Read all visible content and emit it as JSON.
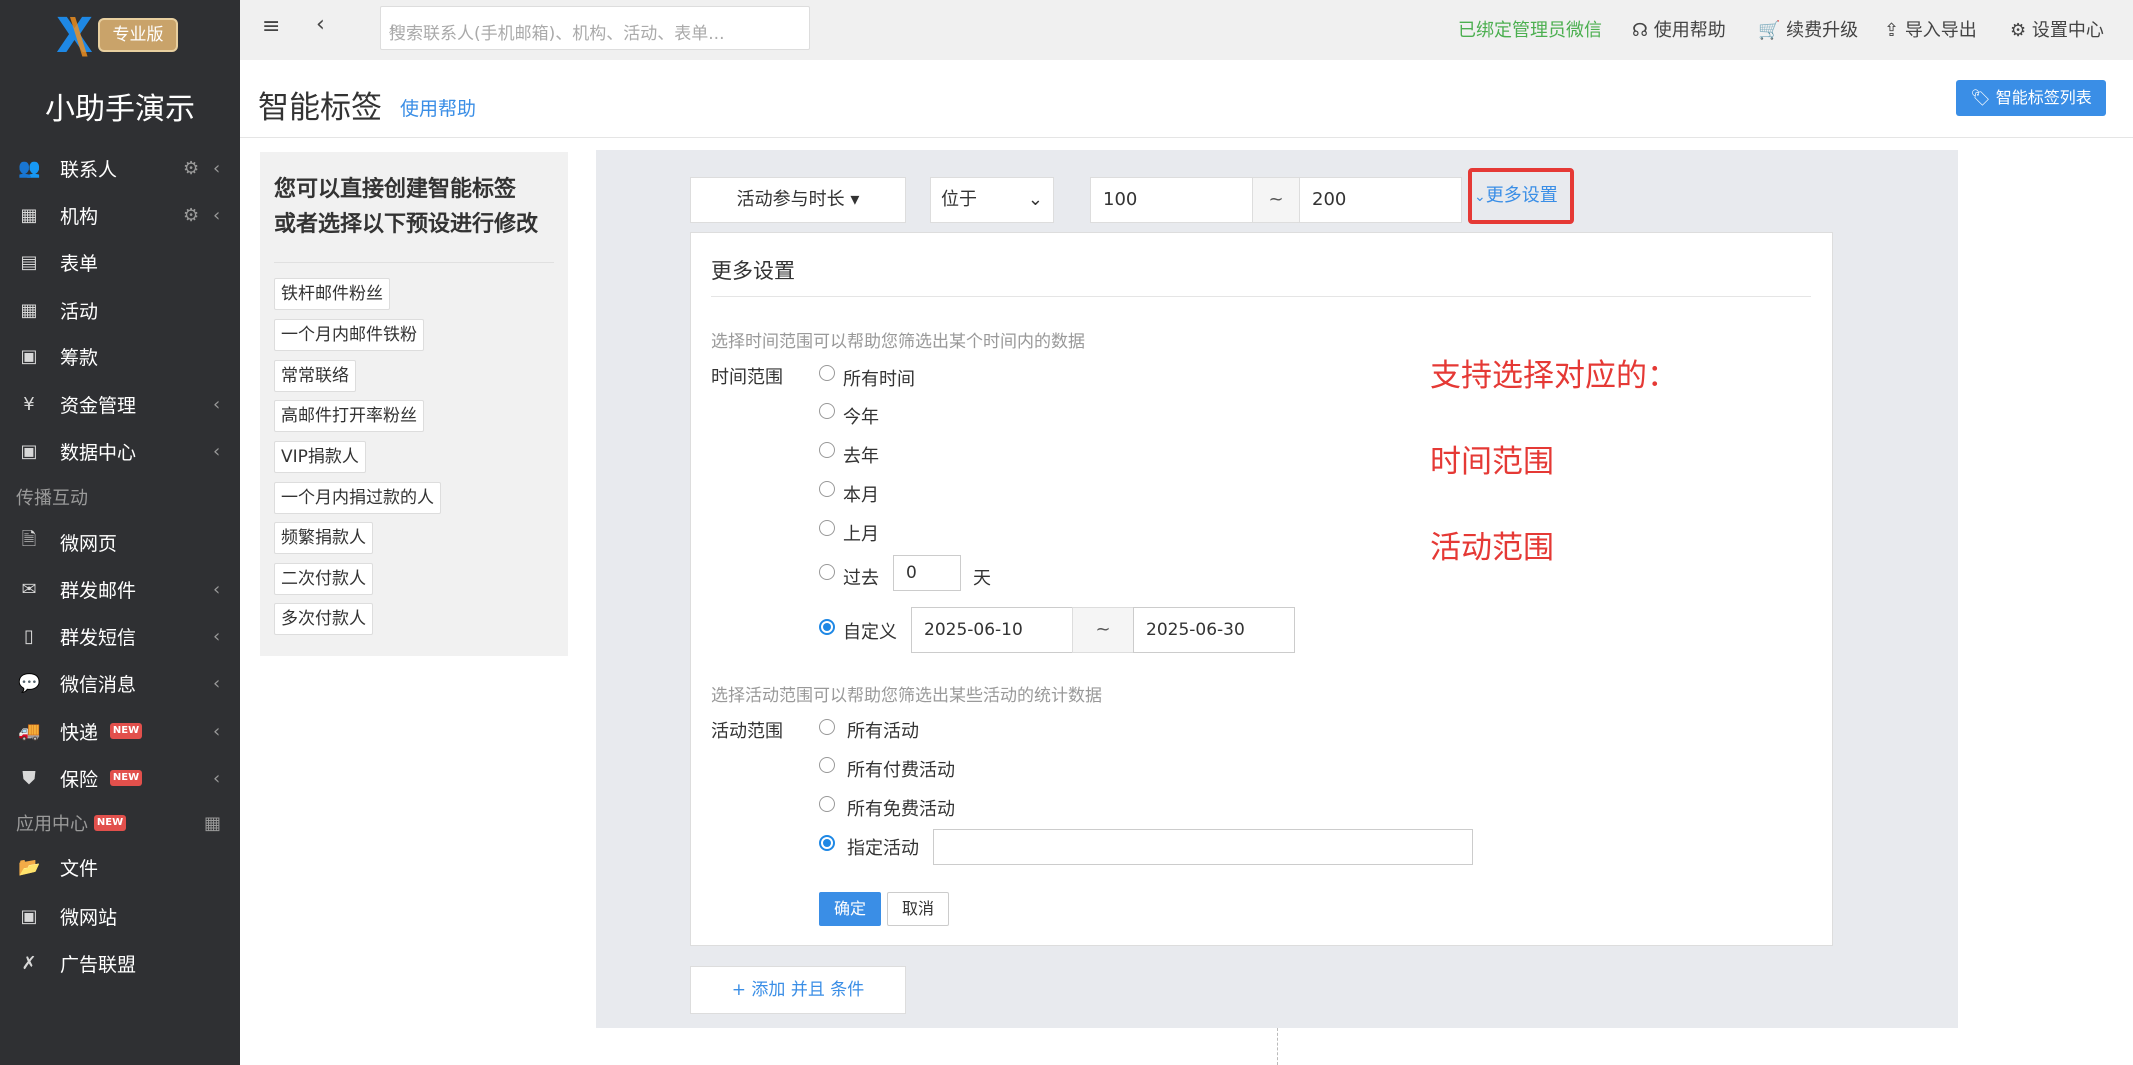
{
  "brand": {
    "badge": "专业版",
    "app_name": "小助手演示"
  },
  "sidebar": {
    "items": [
      {
        "label": "联系人",
        "icon": "users-icon"
      },
      {
        "label": "机构",
        "icon": "building-icon"
      },
      {
        "label": "表单",
        "icon": "clipboard-icon"
      },
      {
        "label": "活动",
        "icon": "calendar-icon"
      },
      {
        "label": "筹款",
        "icon": "fundraise-icon"
      },
      {
        "label": "资金管理",
        "icon": "yen-icon"
      },
      {
        "label": "数据中心",
        "icon": "data-icon"
      },
      {
        "label": "微网页",
        "icon": "page-icon"
      },
      {
        "label": "群发邮件",
        "icon": "mail-icon"
      },
      {
        "label": "群发短信",
        "icon": "phone-icon"
      },
      {
        "label": "微信消息",
        "icon": "wechat-icon"
      },
      {
        "label": "快递",
        "icon": "truck-icon"
      },
      {
        "label": "保险",
        "icon": "shield-icon"
      },
      {
        "label": "文件",
        "icon": "folder-icon"
      },
      {
        "label": "微网站",
        "icon": "site-icon"
      },
      {
        "label": "广告联盟",
        "icon": "ad-icon"
      }
    ],
    "section_spread": "传播互动",
    "section_apps": "应用中心",
    "new_badge": "NEW"
  },
  "topbar": {
    "search_placeholder": "搜索联系人(手机邮箱)、机构、活动、表单...",
    "wechat_bound": "已绑定管理员微信",
    "help": "使用帮助",
    "upgrade": "续费升级",
    "import_export": "导入导出",
    "settings": "设置中心"
  },
  "header": {
    "title": "智能标签",
    "help": "使用帮助",
    "list_button": "智能标签列表"
  },
  "presets": {
    "title_line1": "您可以直接创建智能标签",
    "title_line2": "或者选择以下预设进行修改",
    "tags": [
      "铁杆邮件粉丝",
      "一个月内邮件铁粉",
      "常常联络",
      "高邮件打开率粉丝",
      "VIP捐款人",
      "一个月内捐过款的人",
      "频繁捐款人",
      "二次付款人",
      "多次付款人"
    ]
  },
  "condition": {
    "field": "活动参与时长",
    "operator": "位于",
    "min": "100",
    "tilde": "~",
    "max": "200",
    "more_settings": "更多设置"
  },
  "more": {
    "title": "更多设置",
    "time_hint": "选择时间范围可以帮助您筛选出某个时间内的数据",
    "time_label": "时间范围",
    "time_options": [
      "所有时间",
      "今年",
      "去年",
      "本月",
      "上月"
    ],
    "past_label": "过去",
    "past_value": "0",
    "past_unit": "天",
    "custom_label": "自定义",
    "date_from": "2025-06-10",
    "date_to": "2025-06-30",
    "activity_hint": "选择活动范围可以帮助您筛选出某些活动的统计数据",
    "activity_label": "活动范围",
    "activity_options": [
      "所有活动",
      "所有付费活动",
      "所有免费活动",
      "指定活动"
    ],
    "ok": "确定",
    "cancel": "取消"
  },
  "annotation": {
    "line1": "支持选择对应的：",
    "line2": "时间范围",
    "line3": "活动范围"
  },
  "add_condition": "+ 添加 并且 条件",
  "colors": {
    "accent": "#3a8ee6",
    "annotation": "#e53935",
    "sidebar": "#2f3033"
  }
}
